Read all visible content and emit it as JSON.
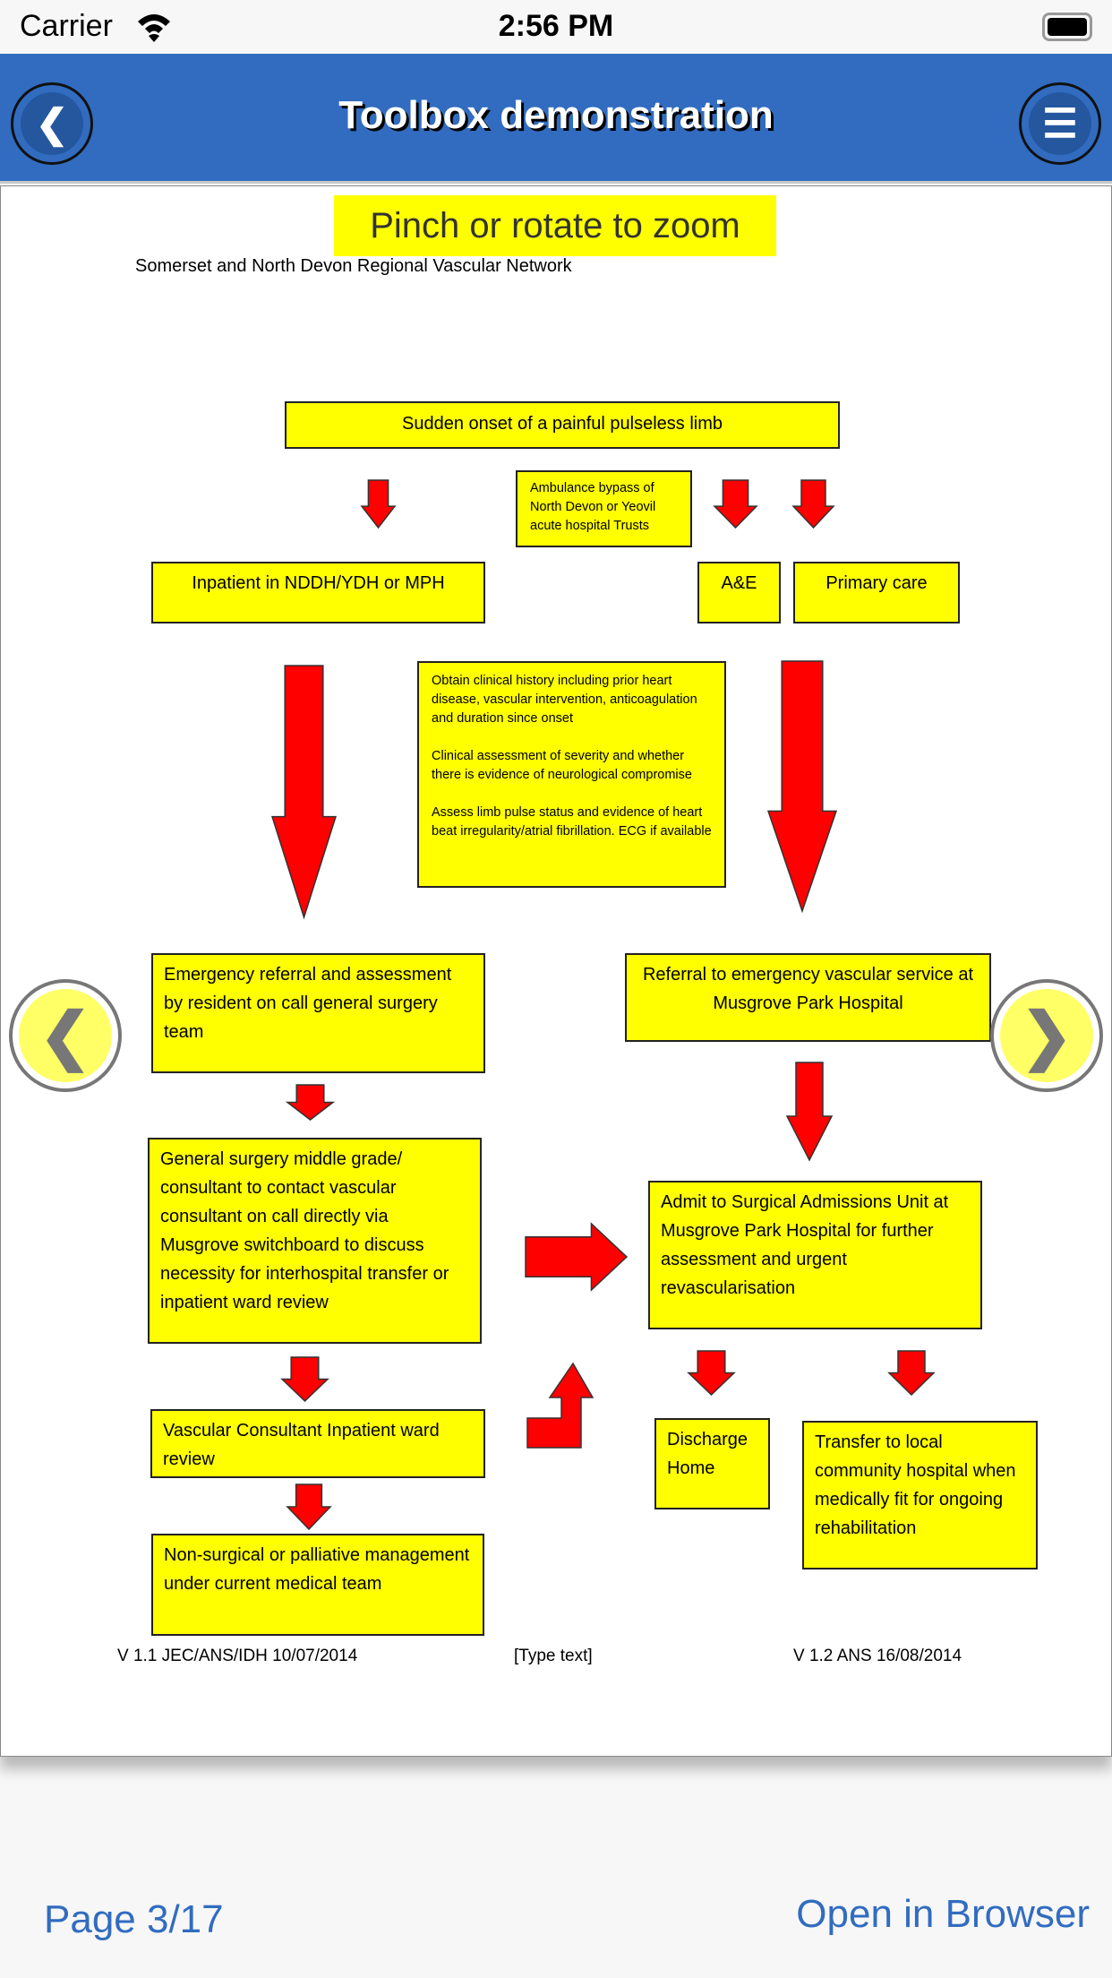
{
  "status_bar": {
    "carrier": "Carrier",
    "time": "2:56 PM"
  },
  "header": {
    "title": "Toolbox demonstration",
    "back_icon": "chevron-left-icon",
    "menu_icon": "hamburger-menu-icon"
  },
  "document": {
    "hint": "Pinch or rotate to zoom",
    "subtitle": "Somerset and North Devon Regional Vascular Network",
    "boxes": {
      "onset": "Sudden onset of a painful pulseless limb",
      "ambulance": "Ambulance bypass of North Devon or Yeovil acute hospital Trusts",
      "inpatient": "Inpatient in NDDH/YDH or MPH",
      "ae": "A&E",
      "primary": "Primary care",
      "clinical": [
        "Obtain clinical history including prior heart disease, vascular intervention, anticoagulation and duration since onset",
        "Clinical assessment of severity and whether there is evidence of neurological compromise",
        "Assess limb pulse status and evidence of heart beat irregularity/atrial fibrillation. ECG if available"
      ],
      "emergency": "Emergency referral and assessment by resident on call general surgery team",
      "referral": "Referral to emergency vascular service at Musgrove Park Hospital",
      "general": "General surgery middle grade/ consultant to contact vascular consultant on call directly via Musgrove switchboard to discuss necessity for interhospital transfer or inpatient ward review",
      "admit": "Admit to Surgical Admissions Unit at Musgrove Park Hospital for further assessment and urgent revascularisation",
      "vascular": "Vascular Consultant Inpatient ward review",
      "discharge": "Discharge Home",
      "transfer": "Transfer to local community hospital when medically fit for ongoing rehabilitation",
      "nonsurgical": "Non-surgical or palliative management under current medical team"
    },
    "footer": {
      "left": "V 1.1 JEC/ANS/IDH 10/07/2014",
      "center": "[Type text]",
      "right": "V 1.2 ANS 16/08/2014"
    },
    "colors": {
      "box": "#ffff00",
      "arrow": "#ff0000"
    }
  },
  "nav": {
    "prev_icon": "chevron-left-icon",
    "next_icon": "chevron-right-icon"
  },
  "bottom_bar": {
    "page": "Page 3/17",
    "open_browser": "Open in Browser"
  }
}
